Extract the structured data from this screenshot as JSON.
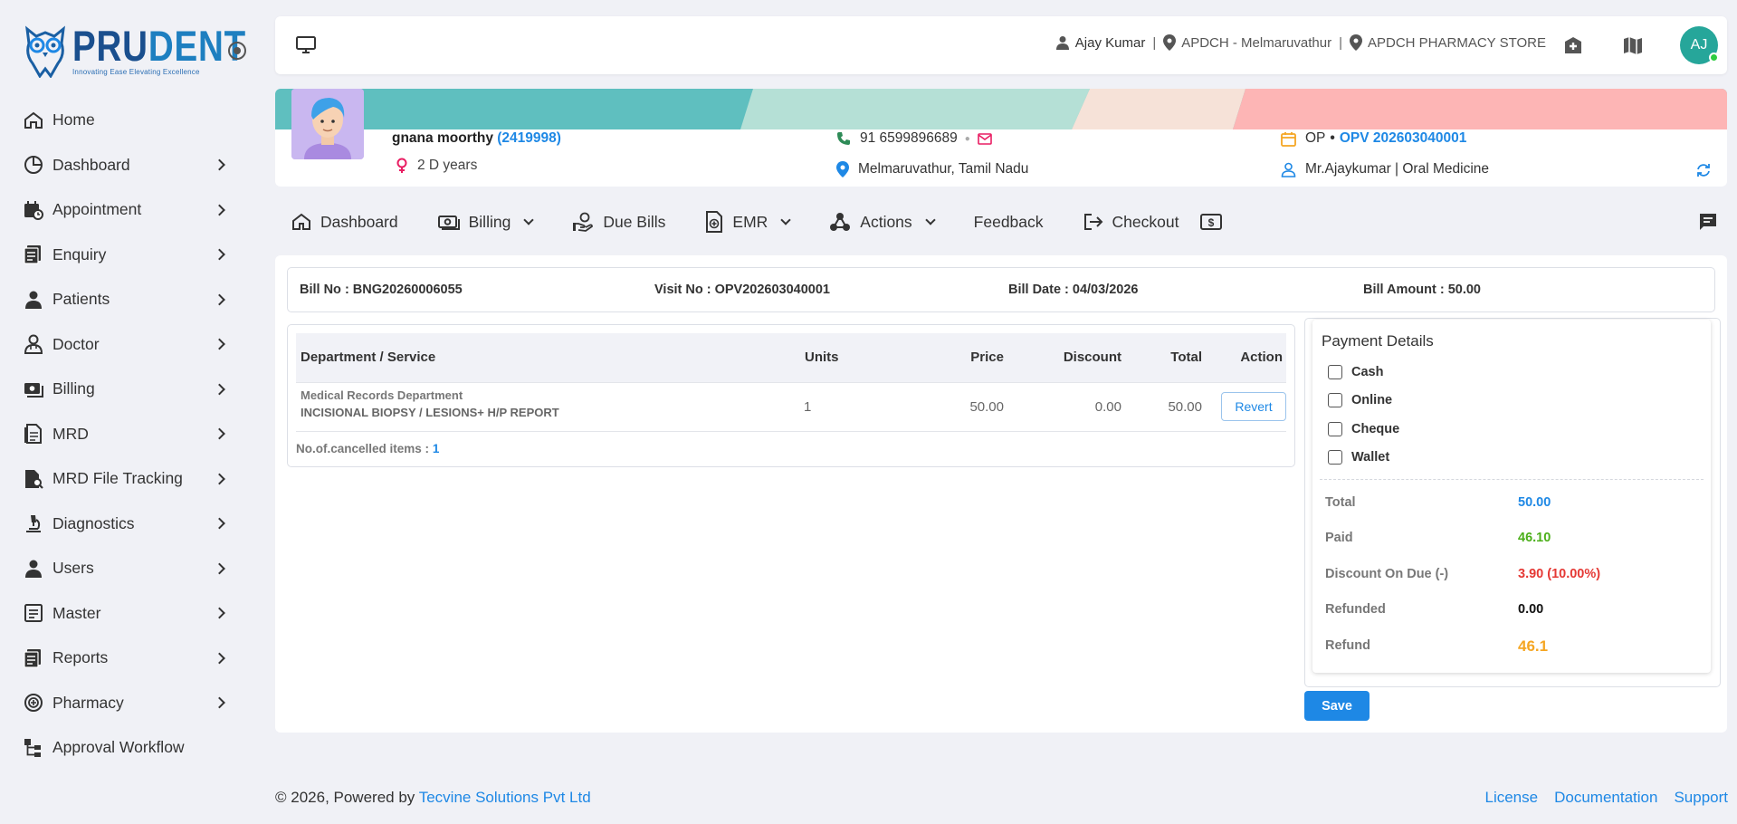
{
  "brand": {
    "name_part1": "PRU",
    "name_part2": "DENT",
    "tagline": "Innovating Ease Elevating Excellence"
  },
  "sidebar": {
    "items": [
      {
        "label": "Home",
        "icon": "home-icon",
        "has_children": false
      },
      {
        "label": "Dashboard",
        "icon": "pie-chart-icon",
        "has_children": true
      },
      {
        "label": "Appointment",
        "icon": "calendar-clock-icon",
        "has_children": true
      },
      {
        "label": "Enquiry",
        "icon": "enquiry-icon",
        "has_children": true
      },
      {
        "label": "Patients",
        "icon": "person-icon",
        "has_children": true
      },
      {
        "label": "Doctor",
        "icon": "doctor-icon",
        "has_children": true
      },
      {
        "label": "Billing",
        "icon": "cash-icon",
        "has_children": true
      },
      {
        "label": "MRD",
        "icon": "document-icon",
        "has_children": true
      },
      {
        "label": "MRD File Tracking",
        "icon": "file-search-icon",
        "has_children": true
      },
      {
        "label": "Diagnostics",
        "icon": "microscope-icon",
        "has_children": true
      },
      {
        "label": "Users",
        "icon": "user-icon",
        "has_children": true
      },
      {
        "label": "Master",
        "icon": "list-box-icon",
        "has_children": true
      },
      {
        "label": "Reports",
        "icon": "report-icon",
        "has_children": true
      },
      {
        "label": "Pharmacy",
        "icon": "pharmacy-icon",
        "has_children": true
      },
      {
        "label": "Approval Workflow",
        "icon": "workflow-icon",
        "has_children": false
      }
    ]
  },
  "header": {
    "user": "Ajay Kumar",
    "location": "APDCH - Melmaruvathur",
    "store": "APDCH PHARMACY STORE",
    "avatar_initials": "AJ"
  },
  "patient": {
    "name": "gnana moorthy",
    "id": "(2419998)",
    "age": "2 D years",
    "phone": "91 6599896689",
    "address": "Melmaruvathur, Tamil Nadu",
    "visit_type": "OP",
    "visit_no": "OPV 202603040001",
    "doctor": "Mr.Ajaykumar | Oral Medicine"
  },
  "menu": {
    "dashboard": "Dashboard",
    "billing": "Billing",
    "due_bills": "Due Bills",
    "emr": "EMR",
    "actions": "Actions",
    "feedback": "Feedback",
    "checkout": "Checkout"
  },
  "bill": {
    "bill_no": "Bill No : BNG20260006055",
    "visit_no": "Visit No : OPV202603040001",
    "bill_date": "Bill Date : 04/03/2026",
    "bill_amount": "Bill Amount : 50.00"
  },
  "services": {
    "headers": {
      "dept": "Department / Service",
      "units": "Units",
      "price": "Price",
      "discount": "Discount",
      "total": "Total",
      "action": "Action"
    },
    "rows": [
      {
        "dept": "Medical Records Department",
        "service": "INCISIONAL BIOPSY / LESIONS+ H/P REPORT",
        "units": "1",
        "price": "50.00",
        "discount": "0.00",
        "total": "50.00",
        "action": "Revert"
      }
    ],
    "cancelled_label": "No.of.cancelled items :",
    "cancelled_count": "1"
  },
  "payment": {
    "title": "Payment Details",
    "modes": [
      "Cash",
      "Online",
      "Cheque",
      "Wallet"
    ],
    "summary": {
      "total_label": "Total",
      "total": "50.00",
      "paid_label": "Paid",
      "paid": "46.10",
      "discount_label": "Discount On Due (-)",
      "discount": "3.90 (10.00%)",
      "refunded_label": "Refunded",
      "refunded": "0.00",
      "refund_label": "Refund",
      "refund": "46.1"
    },
    "colors": {
      "total": "#1e88e5",
      "paid": "#4caf1a",
      "discount": "#e53935",
      "refund": "#f5a623"
    },
    "save_label": "Save"
  },
  "footer": {
    "copyright": "© 2026, Powered by",
    "company": "Tecvine Solutions Pvt Ltd",
    "links": [
      "License",
      "Documentation",
      "Support"
    ]
  }
}
